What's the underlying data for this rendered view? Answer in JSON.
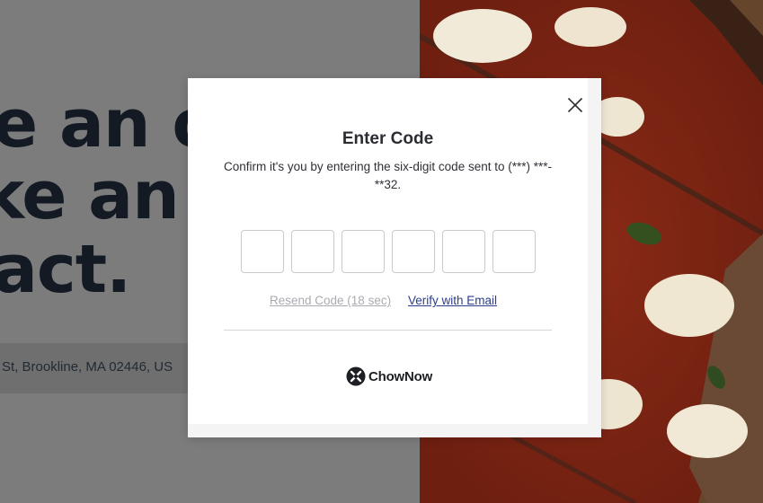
{
  "background": {
    "headline_lines": [
      "e an o",
      "ke an",
      "act."
    ],
    "address_text": "St, Brookline, MA 02446, US"
  },
  "modal": {
    "title": "Enter Code",
    "description": "Confirm it's you by entering the six-digit code sent to (***) ***-**32.",
    "code_digits": [
      "",
      "",
      "",
      "",
      "",
      ""
    ],
    "resend_label": "Resend Code (18 sec)",
    "verify_email_label": "Verify with Email",
    "brand_name": "ChowNow",
    "icons": {
      "close": "close-icon",
      "brand": "chownow-logo-icon"
    }
  },
  "colors": {
    "overlay": "#7b7b7b",
    "headline": "#131a24",
    "link": "#2b3e8c",
    "disabled_link": "#a9abb0",
    "input_border": "#c7c9cd"
  }
}
